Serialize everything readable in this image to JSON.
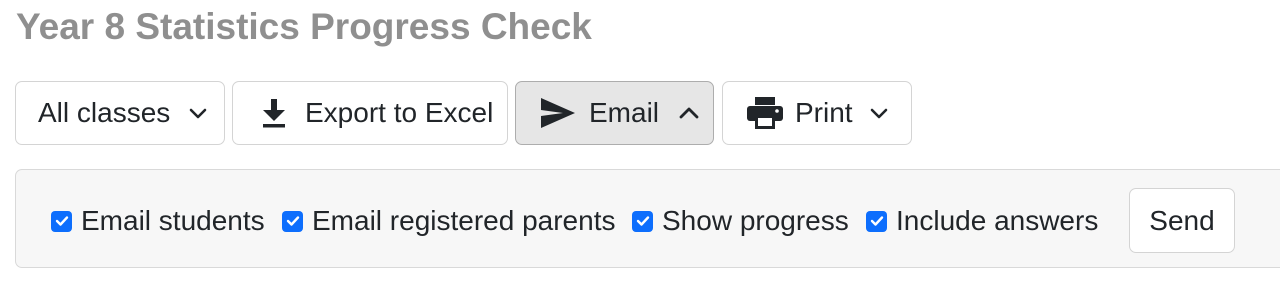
{
  "page": {
    "title": "Year 8 Statistics Progress Check"
  },
  "toolbar": {
    "classes_label": "All classes",
    "export_label": "Export to Excel",
    "email_label": "Email",
    "print_label": "Print"
  },
  "email_panel": {
    "options": [
      {
        "label": "Email students",
        "checked": true
      },
      {
        "label": "Email registered parents",
        "checked": true
      },
      {
        "label": "Show progress",
        "checked": true
      },
      {
        "label": "Include answers",
        "checked": true
      }
    ],
    "send_label": "Send"
  },
  "colors": {
    "checkbox_accent": "#0d6efd",
    "title_gray": "#8f8f8f",
    "panel_bg": "#f7f7f7",
    "active_button_bg": "#e6e6e6"
  },
  "icons": {
    "classes": "chevron-down-icon",
    "export": "download-icon",
    "email": "send-icon",
    "email_toggle": "chevron-up-icon",
    "print": "printer-icon",
    "print_toggle": "chevron-down-icon",
    "checkbox": "checkmark-icon"
  }
}
